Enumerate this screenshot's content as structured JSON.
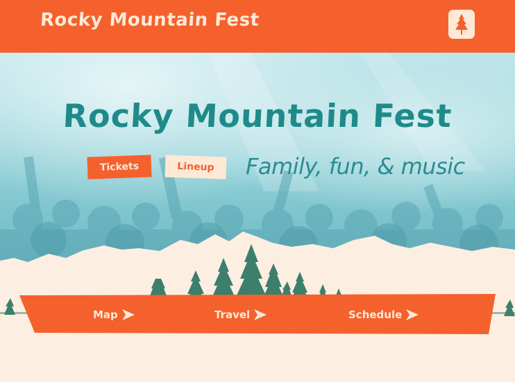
{
  "brand": {
    "logo_text": "Rocky Mountain Fest"
  },
  "hero": {
    "title": "Rocky Mountain Fest",
    "tagline": "Family, fun, & music",
    "buttons": {
      "tickets": "Tickets",
      "lineup": "Lineup"
    }
  },
  "nav": {
    "items": [
      {
        "label": "Map"
      },
      {
        "label": "Travel"
      },
      {
        "label": "Schedule"
      }
    ]
  },
  "colors": {
    "orange": "#f4612d",
    "cream": "#fde9d6",
    "teal": "#1f8a8a",
    "pine": "#3b7f6c"
  },
  "icons": {
    "menu": "pine-tree-icon",
    "nav_arrow": "arrow-right-icon"
  }
}
